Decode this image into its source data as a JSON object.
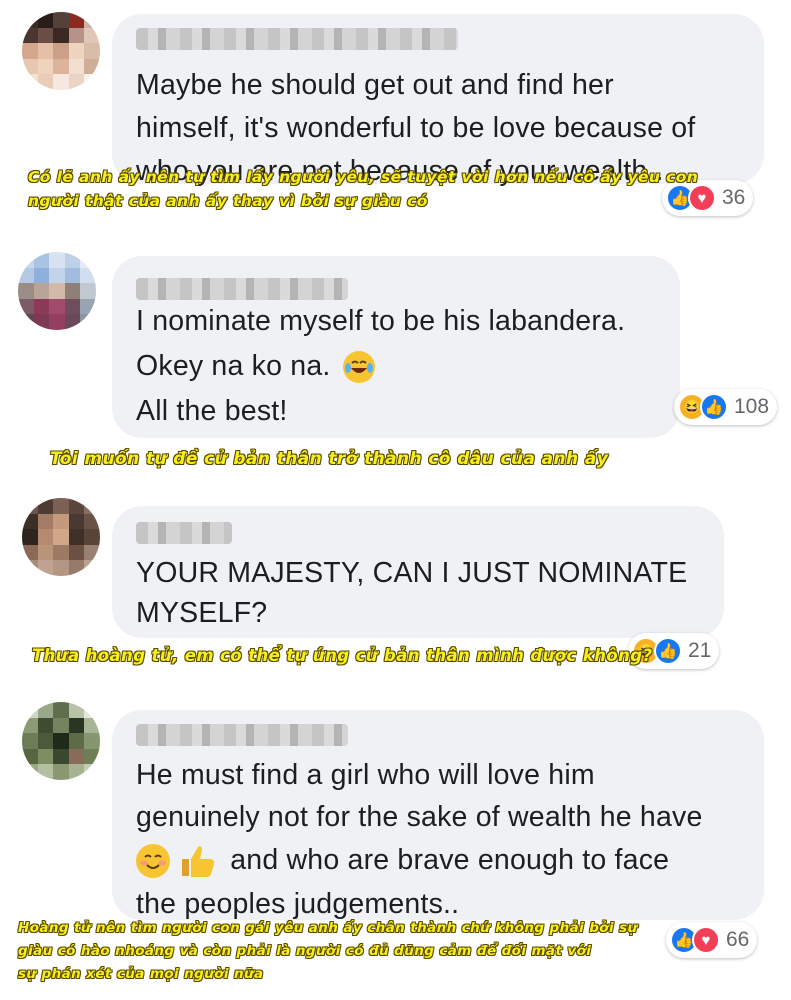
{
  "comments": [
    {
      "lines": [
        "Maybe he should get out and find her",
        "himself, it's wonderful to be love because of",
        "who you are not because of your wealth.."
      ],
      "reactions": {
        "icons": [
          "like-icon",
          "love-icon"
        ],
        "count": "36"
      },
      "caption": [
        "Có lẽ anh ấy nên tự tìm lấy người yêu, sẽ tuyệt vời hơn nếu cô ấy yêu con",
        "người thật của anh ấy thay vì bởi sự giàu có"
      ]
    },
    {
      "lines": [
        "I nominate myself to be his labandera.",
        "Okey na ko na.",
        "All the best!"
      ],
      "emoji": "😂",
      "reactions": {
        "icons": [
          "haha-icon",
          "like-icon"
        ],
        "count": "108"
      },
      "caption": [
        "Tôi muốn tự đề cử bản thân trở thành cô dâu của anh ấy"
      ]
    },
    {
      "lines": [
        "YOUR MAJESTY, CAN I JUST NOMINATE",
        "MYSELF?"
      ],
      "reactions": {
        "icons": [
          "haha-icon",
          "like-icon"
        ],
        "count": "21"
      },
      "caption": [
        "Thưa hoàng tử, em có thể tự ứng cử bản thân mình được không?"
      ]
    },
    {
      "lines": [
        "He must find a girl who will love him",
        "genuinely not for the sake of wealth he have",
        "and who are brave enough to face",
        "the peoples judgements.."
      ],
      "emoji": [
        "😊",
        "👍"
      ],
      "reactions": {
        "icons": [
          "like-icon",
          "love-icon"
        ],
        "count": "66"
      },
      "caption": [
        "Hoàng tử nên tìm người con gái yêu anh ấy chân thành chứ không phải bởi sự",
        "giàu có hào nhoáng và còn phải là người có đủ dũng cảm để đối mặt với",
        "sự phán xét của mọi người nữa"
      ]
    }
  ],
  "colors": {
    "bubble": "#f0f1f4",
    "text": "#1c1e21",
    "like": "#1877f2",
    "love": "#f33e58",
    "haha": "#f7b125",
    "caption": "#f7ef1a"
  }
}
